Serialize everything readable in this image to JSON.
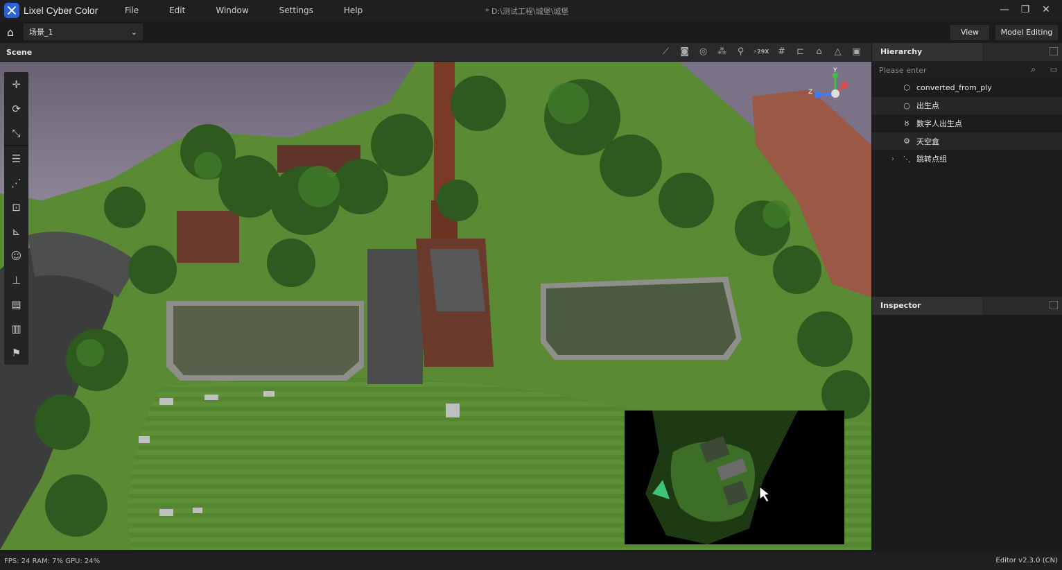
{
  "app": {
    "name": "Lixel Cyber Color",
    "doc_title": "* D:\\测试工程\\城堡\\城堡"
  },
  "menu": [
    "File",
    "Edit",
    "Window",
    "Settings",
    "Help"
  ],
  "scene_selector": {
    "value": "场景_1"
  },
  "view_buttons": {
    "view": "View",
    "model_editing": "Model Editing"
  },
  "scene_panel": {
    "title": "Scene"
  },
  "hierarchy": {
    "title": "Hierarchy",
    "search_placeholder": "Please enter",
    "items": [
      {
        "label": "converted_from_ply",
        "icon": "cube-icon"
      },
      {
        "label": "出生点",
        "icon": "spawn-point-icon"
      },
      {
        "label": "数字人出生点",
        "icon": "person-icon"
      },
      {
        "label": "天空盒",
        "icon": "gear-icon"
      },
      {
        "label": "跳转点组",
        "icon": "jump-group-icon",
        "collapsed": true
      }
    ]
  },
  "inspector": {
    "title": "Inspector"
  },
  "scene_tools": {
    "fps_badge": "29X"
  },
  "gizmo": {
    "y_label": "Y",
    "z_label": "Z"
  },
  "status": {
    "fps": "FPS: 24",
    "ram": "RAM: 7%",
    "gpu": "GPU: 24%",
    "version": "Editor v2.3.0 (CN)"
  },
  "colors": {
    "accent": "#2a63d8",
    "panel": "#1c1c1e",
    "grass": "#5a8a34",
    "water": "#4d5a3e",
    "brick": "#7a3a26"
  }
}
